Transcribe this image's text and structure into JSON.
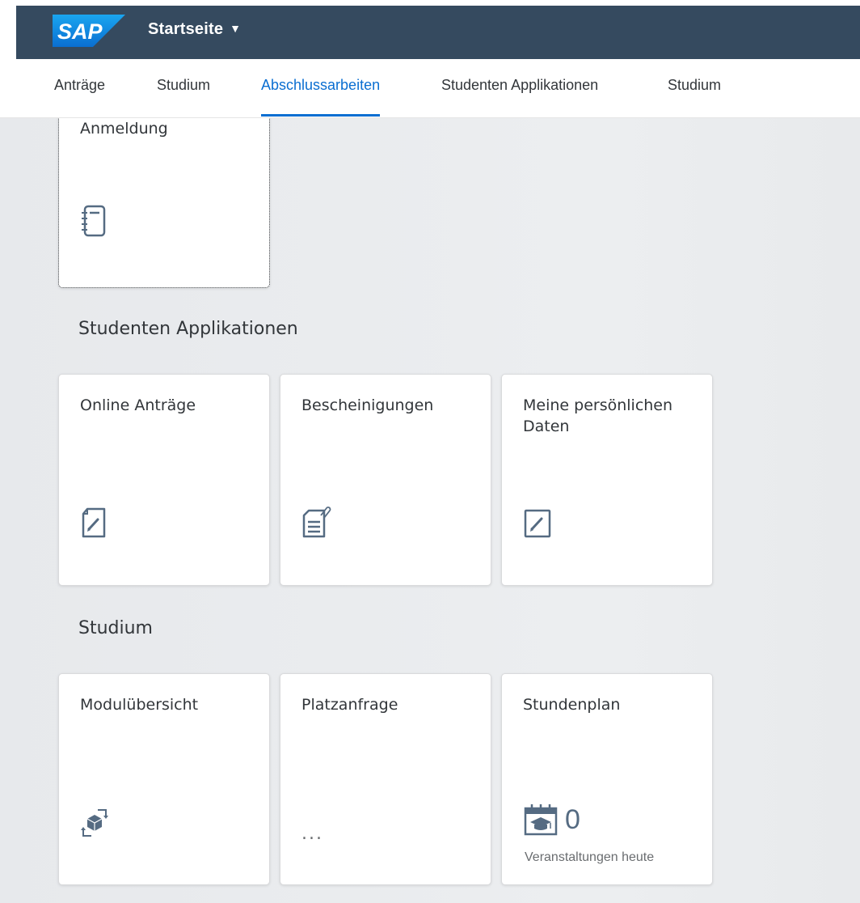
{
  "header": {
    "logo": "SAP",
    "title": "Startseite",
    "title_caret": "▼"
  },
  "tabs": [
    {
      "label": "Anträge"
    },
    {
      "label": "Studium"
    },
    {
      "label": "Abschlussarbeiten"
    },
    {
      "label": "Studenten Applikationen"
    },
    {
      "label": "Studium"
    }
  ],
  "active_tab": "Abschlussarbeiten",
  "colors": {
    "shell": "#354a5f",
    "accent": "#0a6ed1",
    "icon": "#556b82"
  },
  "partial_tile": {
    "title": "Anmeldung",
    "icon": "notebook-icon"
  },
  "groups": [
    {
      "title": "Studenten Applikationen",
      "tiles": [
        {
          "title": "Online Anträge",
          "icon": "edit-document-icon"
        },
        {
          "title": "Bescheinigungen",
          "icon": "attached-document-icon"
        },
        {
          "title": "Meine persönlichen Daten",
          "icon": "edit-icon"
        }
      ]
    },
    {
      "title": "Studium",
      "tiles": [
        {
          "title": "Modulübersicht",
          "icon": "module-transfer-icon"
        },
        {
          "title": "Platzanfrage",
          "ellipsis": "..."
        },
        {
          "title": "Stundenplan",
          "icon": "education-calendar-icon",
          "value": "0",
          "footer": "Veranstaltungen heute"
        }
      ]
    }
  ]
}
